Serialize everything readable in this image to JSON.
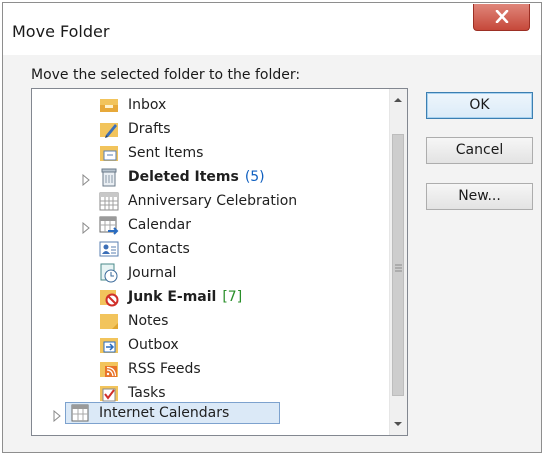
{
  "dialog": {
    "title": "Move Folder",
    "prompt": "Move the selected folder to the folder:"
  },
  "buttons": {
    "ok": "OK",
    "cancel": "Cancel",
    "new": "New..."
  },
  "folders": [
    {
      "label": "Inbox",
      "icon": "inbox-icon",
      "bold": false,
      "count": ""
    },
    {
      "label": "Drafts",
      "icon": "drafts-icon",
      "bold": false,
      "count": ""
    },
    {
      "label": "Sent Items",
      "icon": "sent-items-icon",
      "bold": false,
      "count": ""
    },
    {
      "label": "Deleted Items",
      "icon": "deleted-items-icon",
      "bold": true,
      "count": "(5)",
      "expandable": true
    },
    {
      "label": "Anniversary Celebration",
      "icon": "calendar-grid-icon",
      "bold": false,
      "count": ""
    },
    {
      "label": "Calendar",
      "icon": "calendar-icon",
      "bold": false,
      "count": "",
      "expandable": true
    },
    {
      "label": "Contacts",
      "icon": "contacts-icon",
      "bold": false,
      "count": ""
    },
    {
      "label": "Journal",
      "icon": "journal-icon",
      "bold": false,
      "count": ""
    },
    {
      "label": "Junk E-mail",
      "icon": "junk-email-icon",
      "bold": true,
      "count": "[7]"
    },
    {
      "label": "Notes",
      "icon": "notes-icon",
      "bold": false,
      "count": ""
    },
    {
      "label": "Outbox",
      "icon": "outbox-icon",
      "bold": false,
      "count": ""
    },
    {
      "label": "RSS Feeds",
      "icon": "rss-feeds-icon",
      "bold": false,
      "count": ""
    },
    {
      "label": "Tasks",
      "icon": "tasks-icon",
      "bold": false,
      "count": ""
    },
    {
      "label": "Internet Calendars",
      "icon": "internet-calendars-icon",
      "bold": false,
      "count": "",
      "expandable": true,
      "selected": true
    }
  ],
  "colors": {
    "close_button": "#c6483a",
    "selection": "#dbe9f7",
    "count_blue": "#1060c0",
    "count_green": "#2a8f2a",
    "folder_yellow": "#f2c45c"
  }
}
